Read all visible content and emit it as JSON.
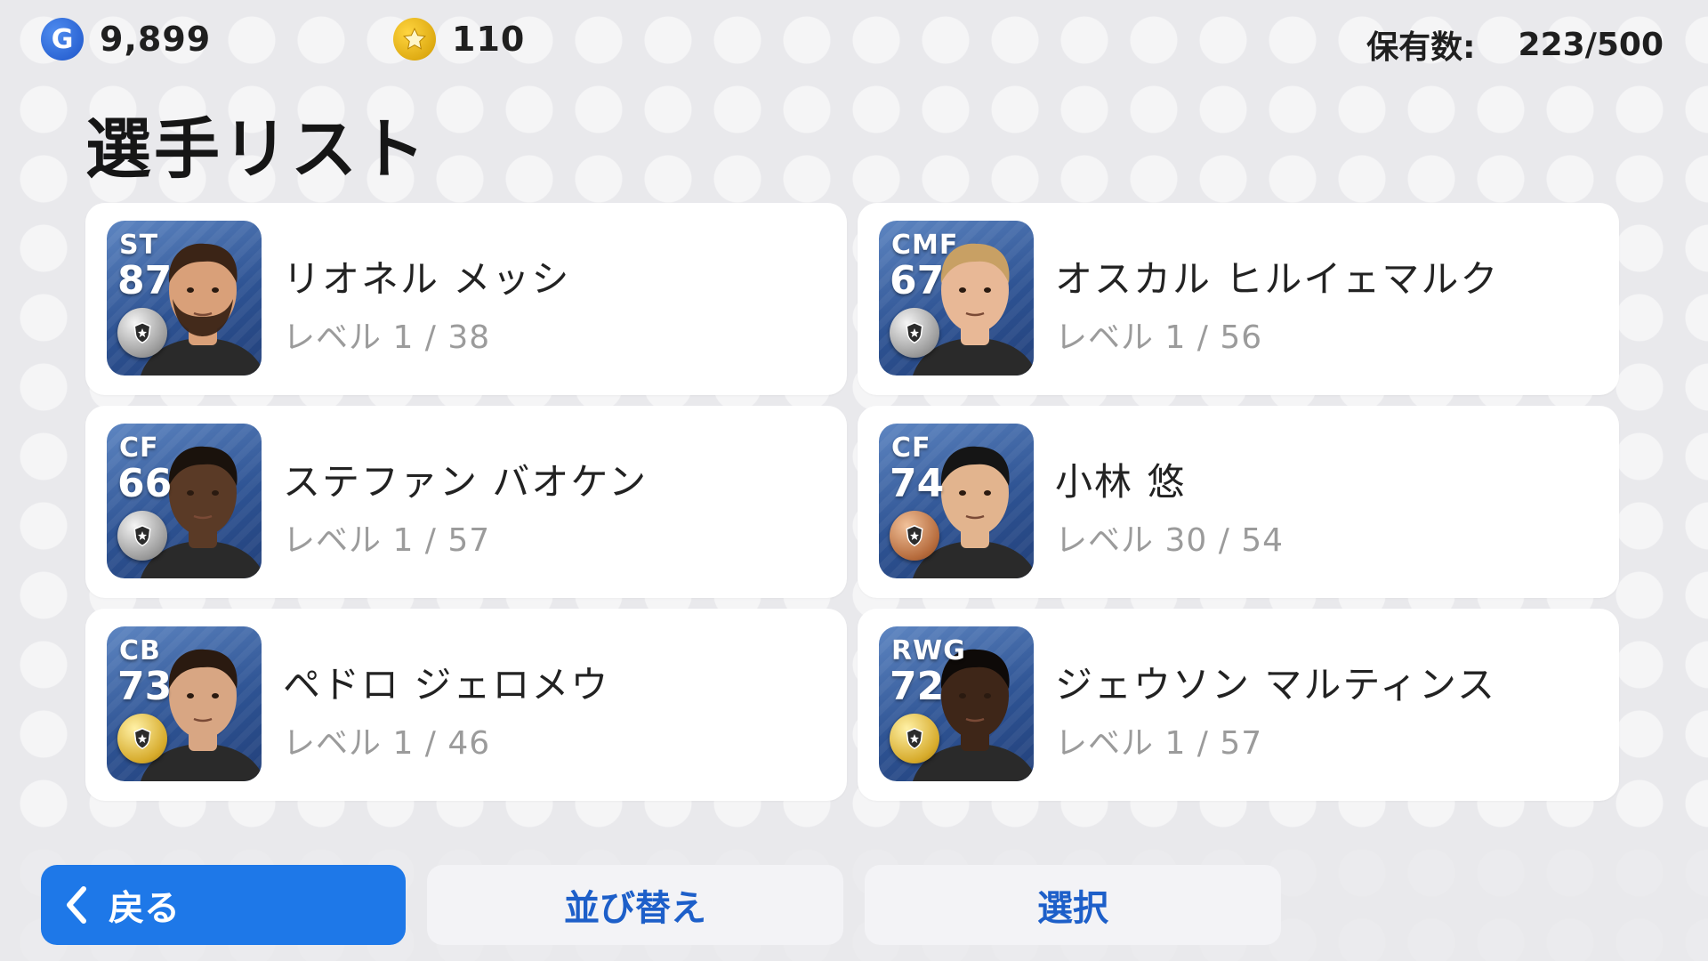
{
  "header": {
    "gp_icon": "G",
    "gp_value": "9,899",
    "coin_icon": "star-coin-icon",
    "coin_value": "110",
    "holdings_label": "保有数:",
    "holdings_value": "223/500"
  },
  "page": {
    "title": "選手リスト"
  },
  "players": [
    {
      "position": "ST",
      "rating": "87",
      "name": "リオネル メッシ",
      "level": "レベル 1 / 38",
      "medal": "silver",
      "skin": "#d9a079",
      "hair": "#3b2416",
      "beard": true
    },
    {
      "position": "CMF",
      "rating": "67",
      "name": "オスカル ヒルイェマルク",
      "level": "レベル 1 / 56",
      "medal": "silver",
      "skin": "#e8b896",
      "hair": "#c8a064",
      "beard": false
    },
    {
      "position": "CF",
      "rating": "66",
      "name": "ステファン バオケン",
      "level": "レベル 1 / 57",
      "medal": "silver",
      "skin": "#5a3a26",
      "hair": "#1a120c",
      "beard": false
    },
    {
      "position": "CF",
      "rating": "74",
      "name": "小林 悠",
      "level": "レベル 30 / 54",
      "medal": "bronze",
      "skin": "#e2b48e",
      "hair": "#151515",
      "beard": false
    },
    {
      "position": "CB",
      "rating": "73",
      "name": "ペドロ ジェロメウ",
      "level": "レベル 1 / 46",
      "medal": "gold",
      "skin": "#d8a683",
      "hair": "#2a1a10",
      "beard": false
    },
    {
      "position": "RWG",
      "rating": "72",
      "name": "ジェウソン マルティンス",
      "level": "レベル 1 / 57",
      "medal": "gold",
      "skin": "#3e2618",
      "hair": "#0e0a08",
      "beard": false
    }
  ],
  "footer": {
    "back_label": "戻る",
    "sort_label": "並び替え",
    "select_label": "選択"
  },
  "colors": {
    "accent_blue": "#1e78e8",
    "button_text_blue": "#1d5fc9",
    "card_background": "#ffffff",
    "page_background": "#e9e9ec"
  }
}
